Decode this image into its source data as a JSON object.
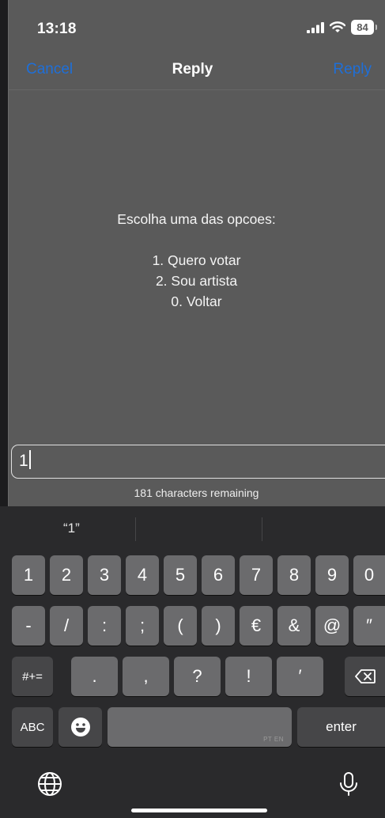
{
  "status": {
    "time": "13:18",
    "battery": "84"
  },
  "nav": {
    "cancel_label": "Cancel",
    "title": "Reply",
    "reply_label": "Reply"
  },
  "message": {
    "intro": "Escolha uma das opcoes:",
    "options": [
      "1. Quero votar",
      "2. Sou artista",
      "0. Voltar"
    ]
  },
  "input": {
    "value": "1",
    "remaining": "181 characters remaining"
  },
  "keyboard": {
    "suggestion": "“1”",
    "row1": [
      "1",
      "2",
      "3",
      "4",
      "5",
      "6",
      "7",
      "8",
      "9",
      "0"
    ],
    "row2": [
      "-",
      "/",
      ":",
      ";",
      "(",
      ")",
      "€",
      "&",
      "@",
      "″"
    ],
    "row3": [
      ".",
      ",",
      "?",
      "!",
      "′"
    ],
    "symbols_label": "#+=",
    "abc_label": "ABC",
    "space_lang": "PT EN",
    "enter_label": "enter"
  },
  "icons": {
    "signal": "signal-icon",
    "wifi": "wifi-icon",
    "battery": "battery-icon",
    "delete": "delete-icon",
    "emoji": "emoji-icon",
    "globe": "globe-icon",
    "mic": "microphone-icon"
  },
  "colors": {
    "accent": "#1e6fd9",
    "keyboard_bg": "#2a2a2c",
    "key": "#6b6b6d",
    "key_dark": "#464648",
    "overlay": "#5a5a5a"
  }
}
